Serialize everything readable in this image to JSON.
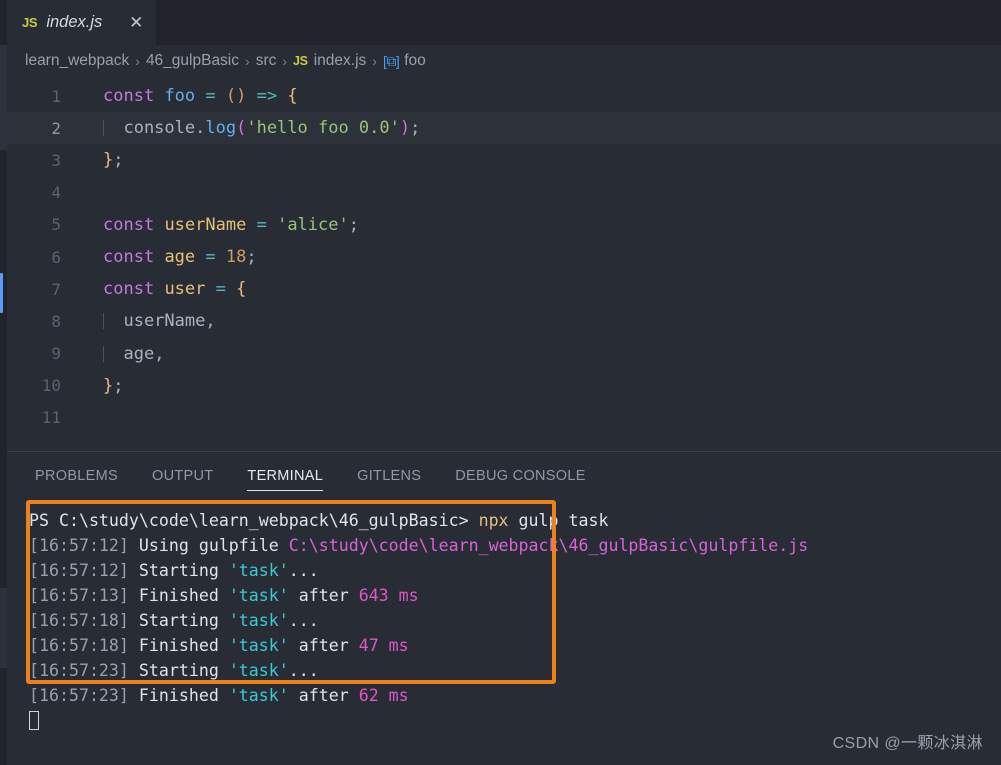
{
  "tab": {
    "icon": "js-file-icon",
    "label": "index.js",
    "close": "✕"
  },
  "breadcrumbs": {
    "items": [
      {
        "label": "learn_webpack",
        "icon": null
      },
      {
        "label": "46_gulpBasic",
        "icon": null
      },
      {
        "label": "src",
        "icon": null
      },
      {
        "label": "index.js",
        "icon": "js-file-icon"
      },
      {
        "label": "foo",
        "icon": "symbol-cube-icon"
      }
    ],
    "separator": "›",
    "js_icon_text": "JS",
    "symbol_icon_text": "[⧉]"
  },
  "editor": {
    "language": "javascript",
    "current_line": 2,
    "lines": [
      {
        "number": "1",
        "indent_guide": false,
        "tokens": [
          {
            "t": "const",
            "c": "tk-kw"
          },
          {
            "t": " ",
            "c": "tk-plain"
          },
          {
            "t": "foo",
            "c": "tk-fn"
          },
          {
            "t": " ",
            "c": "tk-plain"
          },
          {
            "t": "=",
            "c": "tk-op"
          },
          {
            "t": " ",
            "c": "tk-plain"
          },
          {
            "t": "(",
            "c": "tk-br1"
          },
          {
            "t": ")",
            "c": "tk-br1"
          },
          {
            "t": " ",
            "c": "tk-plain"
          },
          {
            "t": "=>",
            "c": "tk-op"
          },
          {
            "t": " ",
            "c": "tk-plain"
          },
          {
            "t": "{",
            "c": "tk-br2"
          }
        ]
      },
      {
        "number": "2",
        "indent_guide": true,
        "tokens": [
          {
            "t": "  console",
            "c": "tk-plain"
          },
          {
            "t": ".",
            "c": "tk-punct"
          },
          {
            "t": "log",
            "c": "tk-fn"
          },
          {
            "t": "(",
            "c": "tk-pink"
          },
          {
            "t": "'hello foo 0.0'",
            "c": "tk-str"
          },
          {
            "t": ")",
            "c": "tk-pink"
          },
          {
            "t": ";",
            "c": "tk-plain"
          }
        ]
      },
      {
        "number": "3",
        "indent_guide": false,
        "tokens": [
          {
            "t": "}",
            "c": "tk-br2"
          },
          {
            "t": ";",
            "c": "tk-plain"
          }
        ]
      },
      {
        "number": "4",
        "indent_guide": false,
        "tokens": []
      },
      {
        "number": "5",
        "indent_guide": false,
        "tokens": [
          {
            "t": "const",
            "c": "tk-kw"
          },
          {
            "t": " ",
            "c": "tk-plain"
          },
          {
            "t": "userName",
            "c": "tk-var"
          },
          {
            "t": " ",
            "c": "tk-plain"
          },
          {
            "t": "=",
            "c": "tk-op"
          },
          {
            "t": " ",
            "c": "tk-plain"
          },
          {
            "t": "'alice'",
            "c": "tk-str"
          },
          {
            "t": ";",
            "c": "tk-plain"
          }
        ]
      },
      {
        "number": "6",
        "indent_guide": false,
        "tokens": [
          {
            "t": "const",
            "c": "tk-kw"
          },
          {
            "t": " ",
            "c": "tk-plain"
          },
          {
            "t": "age",
            "c": "tk-var"
          },
          {
            "t": " ",
            "c": "tk-plain"
          },
          {
            "t": "=",
            "c": "tk-op"
          },
          {
            "t": " ",
            "c": "tk-plain"
          },
          {
            "t": "18",
            "c": "tk-num"
          },
          {
            "t": ";",
            "c": "tk-plain"
          }
        ]
      },
      {
        "number": "7",
        "indent_guide": false,
        "tokens": [
          {
            "t": "const",
            "c": "tk-kw"
          },
          {
            "t": " ",
            "c": "tk-plain"
          },
          {
            "t": "user",
            "c": "tk-var"
          },
          {
            "t": " ",
            "c": "tk-plain"
          },
          {
            "t": "=",
            "c": "tk-op"
          },
          {
            "t": " ",
            "c": "tk-plain"
          },
          {
            "t": "{",
            "c": "tk-br2"
          }
        ]
      },
      {
        "number": "8",
        "indent_guide": true,
        "tokens": [
          {
            "t": "  userName",
            "c": "tk-plain"
          },
          {
            "t": ",",
            "c": "tk-plain"
          }
        ]
      },
      {
        "number": "9",
        "indent_guide": true,
        "tokens": [
          {
            "t": "  age",
            "c": "tk-plain"
          },
          {
            "t": ",",
            "c": "tk-plain"
          }
        ]
      },
      {
        "number": "10",
        "indent_guide": false,
        "tokens": [
          {
            "t": "}",
            "c": "tk-br2"
          },
          {
            "t": ";",
            "c": "tk-plain"
          }
        ]
      },
      {
        "number": "11",
        "indent_guide": false,
        "tokens": []
      }
    ]
  },
  "panel": {
    "tabs": [
      {
        "label": "PROBLEMS",
        "active": false
      },
      {
        "label": "OUTPUT",
        "active": false
      },
      {
        "label": "TERMINAL",
        "active": true
      },
      {
        "label": "GITLENS",
        "active": false
      },
      {
        "label": "DEBUG CONSOLE",
        "active": false
      }
    ],
    "terminal": {
      "lines": [
        {
          "segments": [
            {
              "t": "PS C:\\study\\code\\learn_webpack\\46_gulpBasic> ",
              "c": "t-white"
            },
            {
              "t": "npx",
              "c": "t-yellow"
            },
            {
              "t": " gulp task",
              "c": "t-white"
            }
          ]
        },
        {
          "segments": [
            {
              "t": "[16:57:12]",
              "c": "t-gray"
            },
            {
              "t": " Using gulpfile ",
              "c": "t-white"
            },
            {
              "t": "C:\\study\\code\\learn_webpack\\46_gulpBasic\\gulpfile.js",
              "c": "t-magenta"
            }
          ]
        },
        {
          "segments": [
            {
              "t": "[16:57:12]",
              "c": "t-gray"
            },
            {
              "t": " Starting ",
              "c": "t-white"
            },
            {
              "t": "'task'",
              "c": "t-cyan"
            },
            {
              "t": "...",
              "c": "t-white"
            }
          ]
        },
        {
          "segments": [
            {
              "t": "[16:57:13]",
              "c": "t-gray"
            },
            {
              "t": " Finished ",
              "c": "t-white"
            },
            {
              "t": "'task'",
              "c": "t-cyan"
            },
            {
              "t": " after ",
              "c": "t-white"
            },
            {
              "t": "643 ms",
              "c": "t-pinknum"
            }
          ]
        },
        {
          "segments": [
            {
              "t": "[16:57:18]",
              "c": "t-gray"
            },
            {
              "t": " Starting ",
              "c": "t-white"
            },
            {
              "t": "'task'",
              "c": "t-cyan"
            },
            {
              "t": "...",
              "c": "t-white"
            }
          ]
        },
        {
          "segments": [
            {
              "t": "[16:57:18]",
              "c": "t-gray"
            },
            {
              "t": " Finished ",
              "c": "t-white"
            },
            {
              "t": "'task'",
              "c": "t-cyan"
            },
            {
              "t": " after ",
              "c": "t-white"
            },
            {
              "t": "47 ms",
              "c": "t-pinknum"
            }
          ]
        },
        {
          "segments": [
            {
              "t": "[16:57:23]",
              "c": "t-gray"
            },
            {
              "t": " Starting ",
              "c": "t-white"
            },
            {
              "t": "'task'",
              "c": "t-cyan"
            },
            {
              "t": "...",
              "c": "t-white"
            }
          ]
        },
        {
          "segments": [
            {
              "t": "[16:57:23]",
              "c": "t-gray"
            },
            {
              "t": " Finished ",
              "c": "t-white"
            },
            {
              "t": "'task'",
              "c": "t-cyan"
            },
            {
              "t": " after ",
              "c": "t-white"
            },
            {
              "t": "62 ms",
              "c": "t-pinknum"
            }
          ]
        }
      ]
    }
  },
  "annotation": {
    "highlight_color": "#f08019"
  },
  "watermark": {
    "text": "CSDN @一颗冰淇淋"
  }
}
